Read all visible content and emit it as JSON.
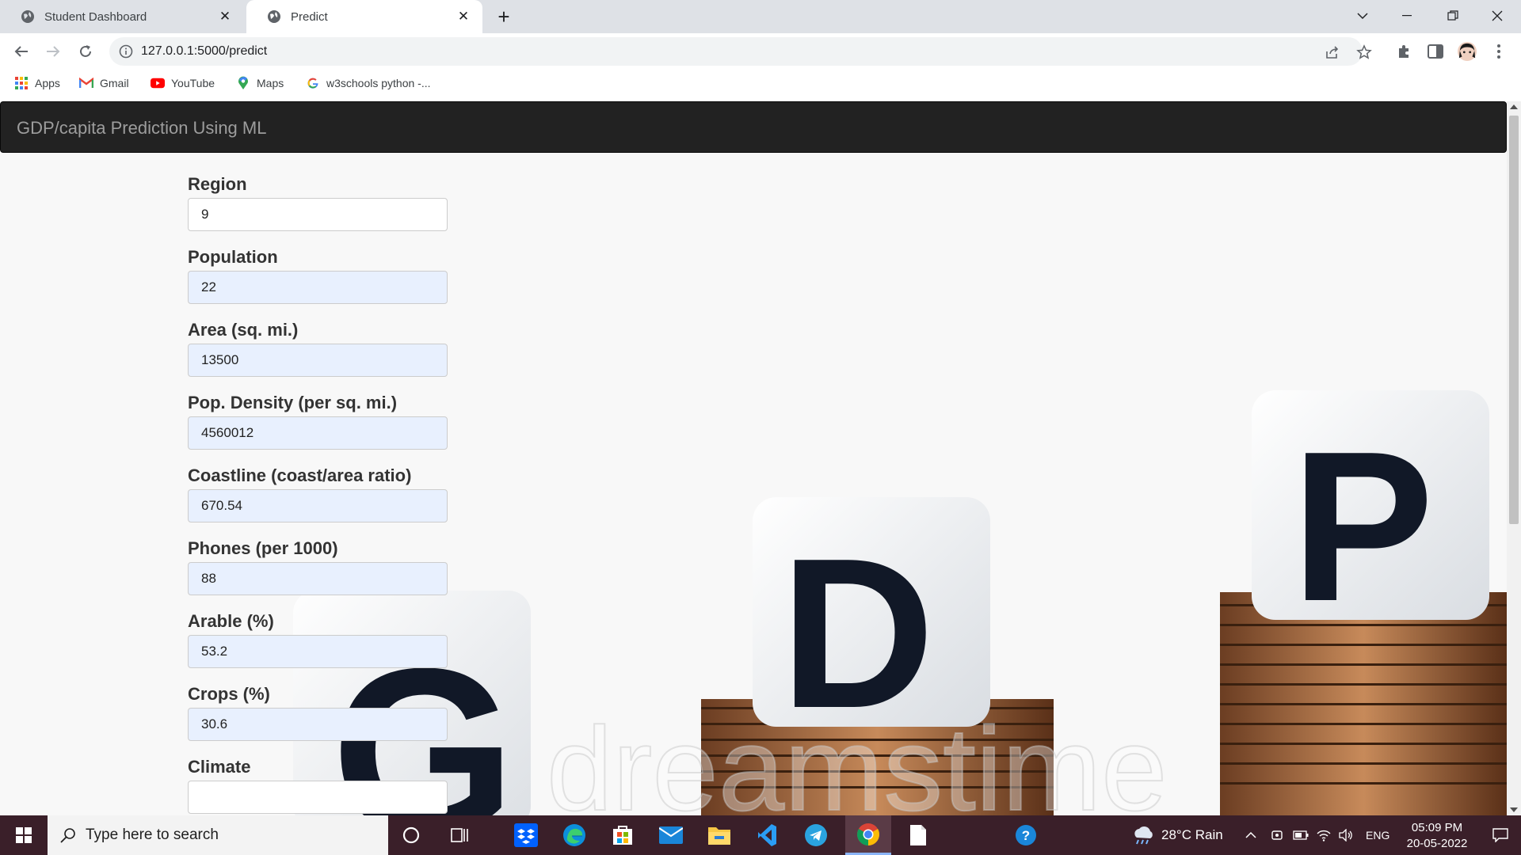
{
  "browser": {
    "tabs": [
      {
        "title": "Student Dashboard",
        "active": false
      },
      {
        "title": "Predict",
        "active": true
      }
    ],
    "url": "127.0.0.1:5000/predict",
    "bookmarks": [
      {
        "label": "Apps",
        "icon": "apps-grid-icon"
      },
      {
        "label": "Gmail",
        "icon": "gmail-icon"
      },
      {
        "label": "YouTube",
        "icon": "youtube-icon"
      },
      {
        "label": "Maps",
        "icon": "maps-icon"
      },
      {
        "label": "w3schools python -...",
        "icon": "google-icon"
      }
    ]
  },
  "page": {
    "brand": "GDP/capita Prediction Using ML",
    "background_letters": [
      "G",
      "D",
      "P"
    ],
    "watermark": "dreamstime",
    "fields": [
      {
        "label": "Region",
        "value": "9"
      },
      {
        "label": "Population",
        "value": "22"
      },
      {
        "label": "Area (sq. mi.)",
        "value": "13500"
      },
      {
        "label": "Pop. Density (per sq. mi.)",
        "value": "4560012"
      },
      {
        "label": "Coastline (coast/area ratio)",
        "value": "670.54"
      },
      {
        "label": "Phones (per 1000)",
        "value": "88"
      },
      {
        "label": "Arable (%)",
        "value": "53.2"
      },
      {
        "label": "Crops (%)",
        "value": "30.6"
      },
      {
        "label": "Climate",
        "value": ""
      }
    ]
  },
  "taskbar": {
    "search_placeholder": "Type here to search",
    "weather": "28°C  Rain",
    "language": "ENG",
    "time": "05:09 PM",
    "date": "20-05-2022"
  },
  "colors": {
    "navbar": "#222222",
    "brand_text": "#9d9d9d",
    "autofill": "#e8f0fe",
    "taskbar": "#3a1f29"
  }
}
